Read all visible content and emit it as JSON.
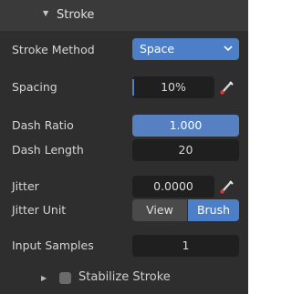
{
  "panel": {
    "title": "Stroke",
    "collapse_icon": "triangle-down-icon"
  },
  "fields": {
    "stroke_method": {
      "label": "Stroke Method",
      "value": "Space"
    },
    "spacing": {
      "label": "Spacing",
      "value": "10%"
    },
    "dash_ratio": {
      "label": "Dash Ratio",
      "value": "1.000"
    },
    "dash_length": {
      "label": "Dash Length",
      "value": "20"
    },
    "jitter": {
      "label": "Jitter",
      "value": "0.0000"
    },
    "jitter_unit": {
      "label": "Jitter Unit",
      "options": [
        "View",
        "Brush"
      ],
      "selected": "Brush"
    },
    "input_samples": {
      "label": "Input Samples",
      "value": "1"
    }
  },
  "subpanel": {
    "label": "Stabilize Stroke",
    "expand_icon": "triangle-right-icon",
    "checked": false
  },
  "colors": {
    "accent": "#4d7fc8",
    "slider_fill": "#5680c2",
    "panel_bg": "#2e2e2e",
    "field_bg": "#1f1f1f"
  }
}
